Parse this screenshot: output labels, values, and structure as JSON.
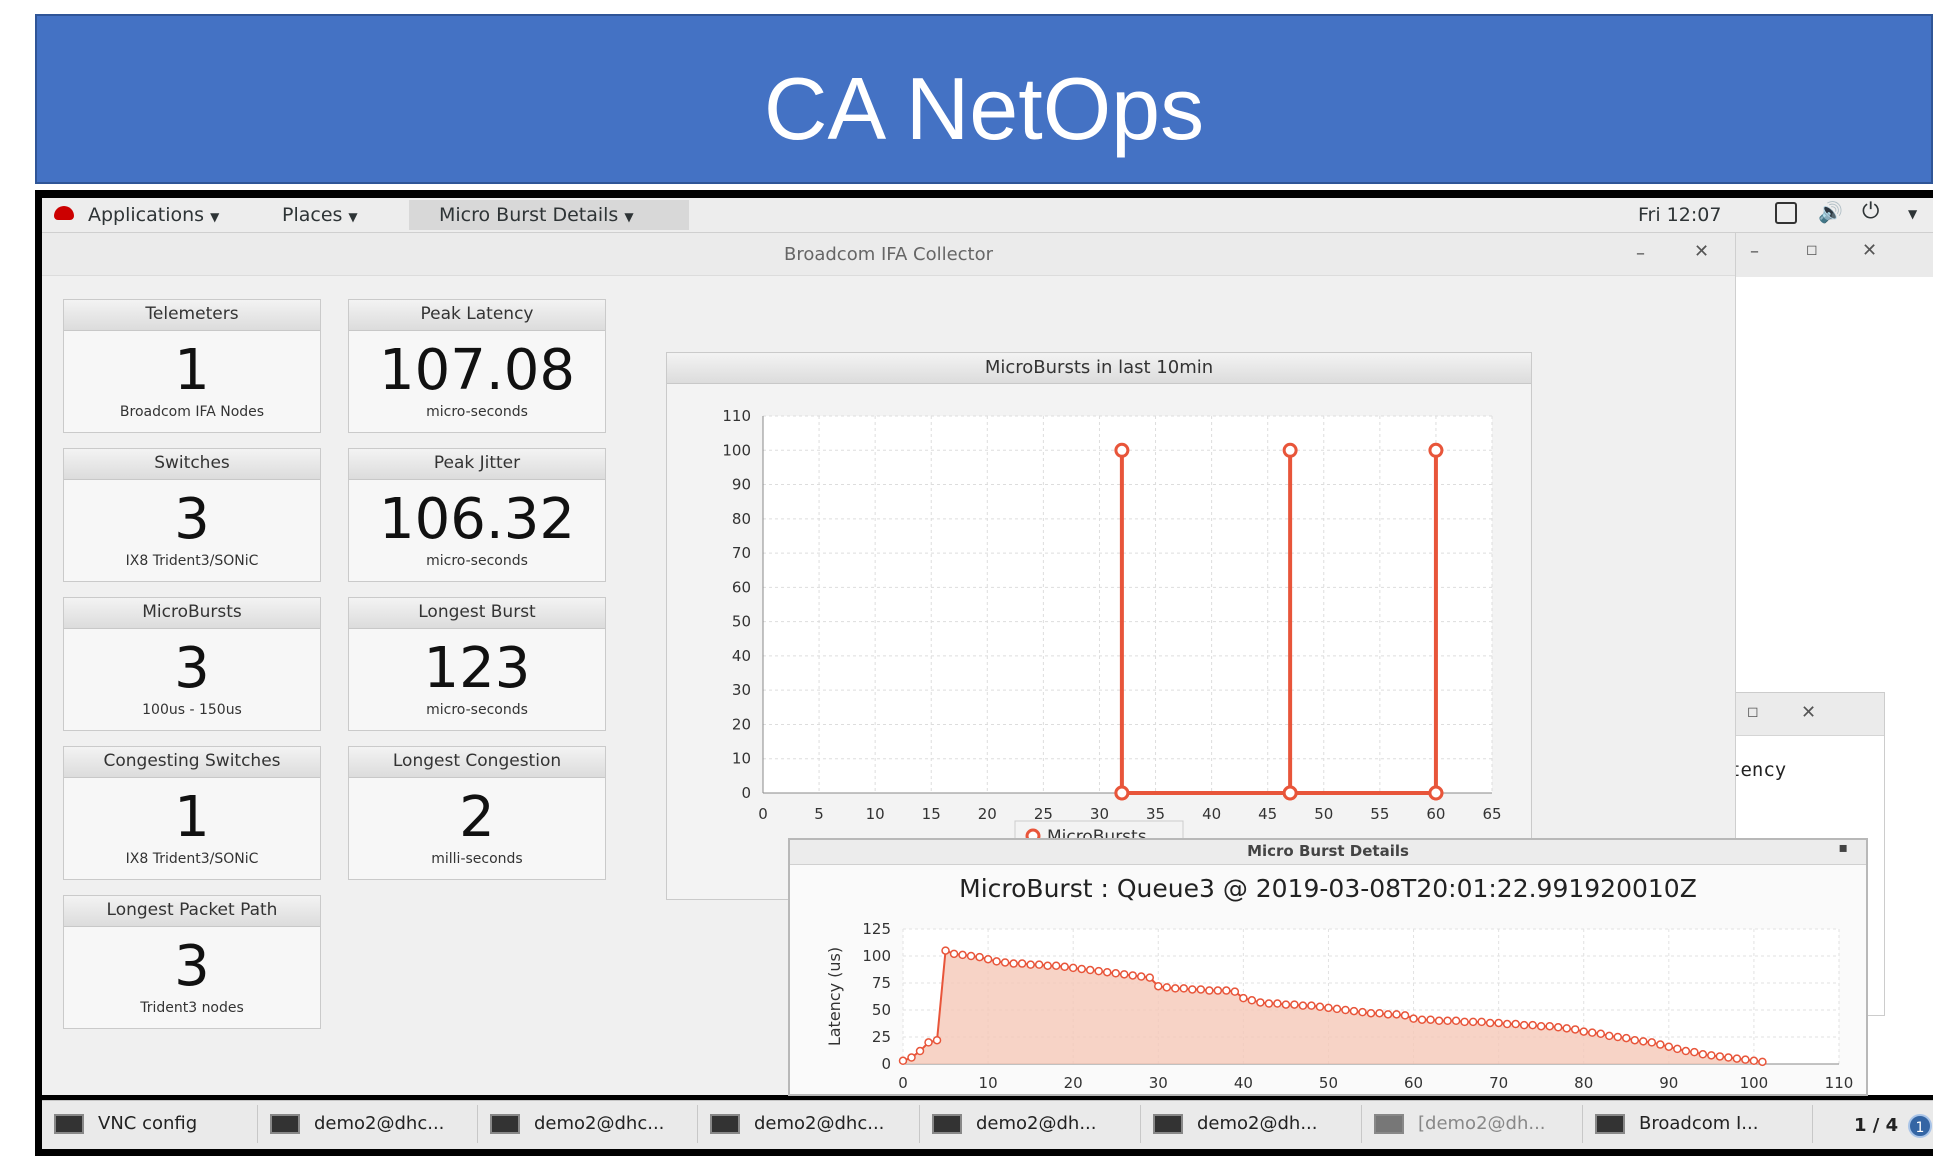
{
  "banner": {
    "title": "CA NetOps"
  },
  "topbar": {
    "applications": "Applications",
    "places": "Places",
    "active_window": "Micro Burst Details",
    "clock": "Fri 12:07"
  },
  "window": {
    "title": "Broadcom IFA Collector"
  },
  "tiles": [
    {
      "title": "Telemeters",
      "value": "1",
      "sub": "Broadcom IFA Nodes"
    },
    {
      "title": "Peak Latency",
      "value": "107.08",
      "sub": "micro-seconds"
    },
    {
      "title": "Switches",
      "value": "3",
      "sub": "IX8 Trident3/SONiC"
    },
    {
      "title": "Peak Jitter",
      "value": "106.32",
      "sub": "micro-seconds"
    },
    {
      "title": "MicroBursts",
      "value": "3",
      "sub": "100us - 150us"
    },
    {
      "title": "Longest Burst",
      "value": "123",
      "sub": "micro-seconds"
    },
    {
      "title": "Congesting Switches",
      "value": "1",
      "sub": "IX8 Trident3/SONiC"
    },
    {
      "title": "Longest Congestion",
      "value": "2",
      "sub": "milli-seconds"
    },
    {
      "title": "Longest Packet Path",
      "value": "3",
      "sub": "Trident3 nodes"
    }
  ],
  "details": {
    "window_title": "Micro Burst Details",
    "title": "MicroBurst : Queue3 @ 2019-03-08T20:01:22.991920010Z"
  },
  "side_window": {
    "text": "tency"
  },
  "taskbar": {
    "items": [
      "VNC config",
      "demo2@dhc...",
      "demo2@dhc...",
      "demo2@dhc...",
      "demo2@dh...",
      "demo2@dh...",
      "[demo2@dh...",
      "Broadcom I..."
    ],
    "workspace": "1 / 4",
    "notifications": "1"
  },
  "colors": {
    "banner": "#4472c4",
    "series": "#e8553a",
    "fill": "#f5c8b8"
  },
  "chart_data": [
    {
      "type": "line",
      "title": "MicroBursts in last 10min",
      "xlim": [
        0,
        65
      ],
      "ylim": [
        0,
        110
      ],
      "xticks": [
        0,
        5,
        10,
        15,
        20,
        25,
        30,
        35,
        40,
        45,
        50,
        55,
        60,
        65
      ],
      "yticks": [
        0,
        10,
        20,
        30,
        40,
        50,
        60,
        70,
        80,
        90,
        100,
        110
      ],
      "grid": true,
      "legend": "bottom",
      "series": [
        {
          "name": "MicroBursts",
          "points": [
            [
              32,
              0
            ],
            [
              32,
              100
            ],
            [
              32,
              0
            ],
            [
              47,
              0
            ],
            [
              47,
              100
            ],
            [
              47,
              0
            ],
            [
              60,
              0
            ],
            [
              60,
              100
            ],
            [
              60,
              0
            ]
          ]
        }
      ]
    },
    {
      "type": "area",
      "ylabel": "Latency (us)",
      "xlim": [
        0,
        110
      ],
      "ylim": [
        0,
        125
      ],
      "xticks": [
        0,
        10,
        20,
        30,
        40,
        50,
        60,
        70,
        80,
        90,
        100,
        110
      ],
      "yticks": [
        0,
        25,
        50,
        75,
        100,
        125
      ],
      "grid": true,
      "series": [
        {
          "points": [
            [
              0,
              3
            ],
            [
              1,
              6
            ],
            [
              2,
              12
            ],
            [
              3,
              20
            ],
            [
              4,
              22
            ],
            [
              5,
              105
            ],
            [
              6,
              102
            ],
            [
              7,
              101
            ],
            [
              8,
              100
            ],
            [
              9,
              99
            ],
            [
              10,
              97
            ],
            [
              11,
              95
            ],
            [
              12,
              94
            ],
            [
              13,
              93
            ],
            [
              14,
              93
            ],
            [
              15,
              92
            ],
            [
              16,
              92
            ],
            [
              17,
              91
            ],
            [
              18,
              91
            ],
            [
              19,
              90
            ],
            [
              20,
              89
            ],
            [
              21,
              88
            ],
            [
              22,
              87
            ],
            [
              23,
              86
            ],
            [
              24,
              85
            ],
            [
              25,
              84
            ],
            [
              26,
              83
            ],
            [
              27,
              82
            ],
            [
              28,
              81
            ],
            [
              29,
              80
            ],
            [
              30,
              72
            ],
            [
              31,
              71
            ],
            [
              32,
              70
            ],
            [
              33,
              70
            ],
            [
              34,
              69
            ],
            [
              35,
              69
            ],
            [
              36,
              68
            ],
            [
              37,
              68
            ],
            [
              38,
              68
            ],
            [
              39,
              67
            ],
            [
              40,
              61
            ],
            [
              41,
              59
            ],
            [
              42,
              57
            ],
            [
              43,
              56
            ],
            [
              44,
              56
            ],
            [
              45,
              55
            ],
            [
              46,
              55
            ],
            [
              47,
              54
            ],
            [
              48,
              54
            ],
            [
              49,
              53
            ],
            [
              50,
              52
            ],
            [
              51,
              51
            ],
            [
              52,
              50
            ],
            [
              53,
              49
            ],
            [
              54,
              48
            ],
            [
              55,
              47
            ],
            [
              56,
              47
            ],
            [
              57,
              46
            ],
            [
              58,
              46
            ],
            [
              59,
              45
            ],
            [
              60,
              42
            ],
            [
              61,
              41
            ],
            [
              62,
              41
            ],
            [
              63,
              40
            ],
            [
              64,
              40
            ],
            [
              65,
              40
            ],
            [
              66,
              39
            ],
            [
              67,
              39
            ],
            [
              68,
              39
            ],
            [
              69,
              38
            ],
            [
              70,
              38
            ],
            [
              71,
              37
            ],
            [
              72,
              37
            ],
            [
              73,
              36
            ],
            [
              74,
              36
            ],
            [
              75,
              35
            ],
            [
              76,
              35
            ],
            [
              77,
              34
            ],
            [
              78,
              33
            ],
            [
              79,
              32
            ],
            [
              80,
              30
            ],
            [
              81,
              29
            ],
            [
              82,
              28
            ],
            [
              83,
              26
            ],
            [
              84,
              25
            ],
            [
              85,
              24
            ],
            [
              86,
              22
            ],
            [
              87,
              21
            ],
            [
              88,
              20
            ],
            [
              89,
              18
            ],
            [
              90,
              16
            ],
            [
              91,
              14
            ],
            [
              92,
              12
            ],
            [
              93,
              11
            ],
            [
              94,
              9
            ],
            [
              95,
              8
            ],
            [
              96,
              7
            ],
            [
              97,
              6
            ],
            [
              98,
              5
            ],
            [
              99,
              4
            ],
            [
              100,
              3
            ],
            [
              101,
              2
            ]
          ]
        }
      ]
    }
  ]
}
